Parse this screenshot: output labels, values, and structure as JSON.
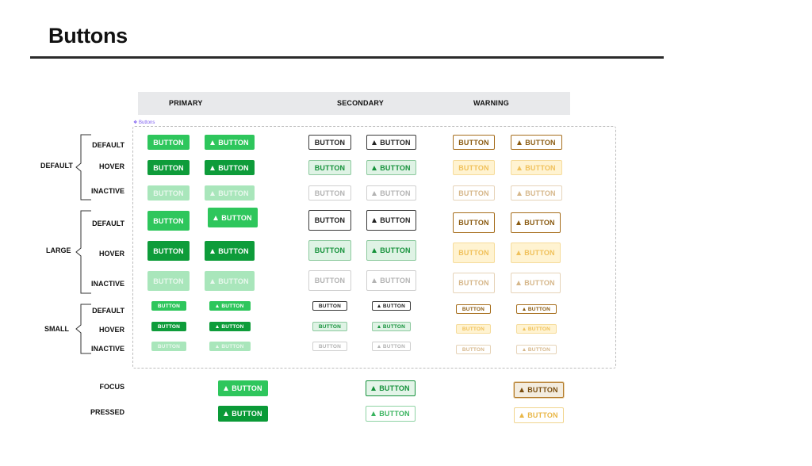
{
  "page": {
    "title": "Buttons"
  },
  "columns": {
    "primary": "PRIMARY",
    "secondary": "SECONDARY",
    "warning": "WARNING"
  },
  "frame_label": "❖ Buttons",
  "groups": {
    "default": "DEFAULT",
    "large": "LARGE",
    "small": "SMALL"
  },
  "states": {
    "default": "DEFAULT",
    "hover": "HOVER",
    "inactive": "INACTIVE",
    "focus": "FOCUS",
    "pressed": "PRESSED"
  },
  "button_label": "BUTTON",
  "icon_names": {
    "leading": "warning-triangle-icon"
  },
  "colors": {
    "primary": "#2ec65c",
    "primary_hover": "#0e9c3a",
    "primary_inactive": "#a9e6bb",
    "secondary_border": "#3a3a3a",
    "secondary_hover": "#dff3e5",
    "warning_text": "#8a5a10",
    "warning_hover": "#fff3d1",
    "frame_outline": "#7c5cf0"
  }
}
